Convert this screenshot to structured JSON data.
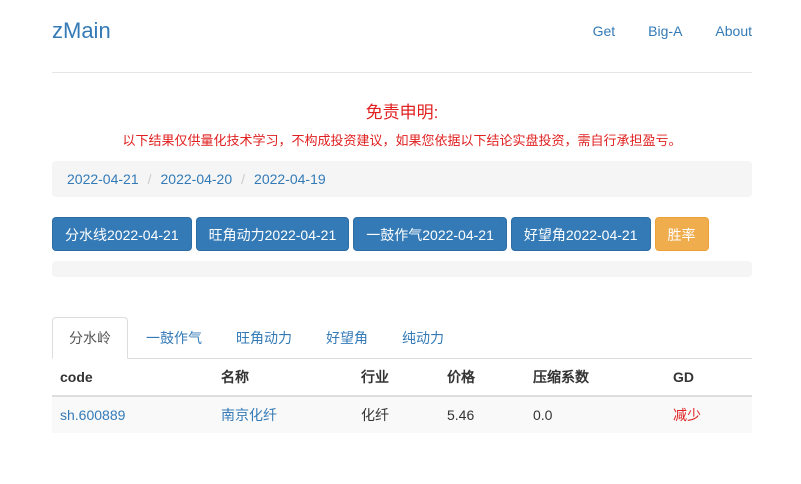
{
  "header": {
    "brand": "zMain",
    "nav": [
      "Get",
      "Big-A",
      "About"
    ]
  },
  "disclaimer": {
    "title": "免责申明:",
    "text": "以下结果仅供量化技术学习，不构成投资建议，如果您依据以下结论实盘投资，需自行承担盈亏。"
  },
  "breadcrumb": [
    "2022-04-21",
    "2022-04-20",
    "2022-04-19"
  ],
  "buttons": [
    "分水线2022-04-21",
    "旺角动力2022-04-21",
    "一鼓作气2022-04-21",
    "好望角2022-04-21",
    "胜率"
  ],
  "tabs": [
    "分水岭",
    "一鼓作气",
    "旺角动力",
    "好望角",
    "纯动力"
  ],
  "table": {
    "headers": [
      "code",
      "名称",
      "行业",
      "价格",
      "压缩系数",
      "GD"
    ],
    "rows": [
      [
        "sh.600889",
        "南京化纤",
        "化纤",
        "5.46",
        "0.0",
        "减少"
      ]
    ]
  },
  "colors": {
    "link": "#337ab7",
    "primary": "#337ab7",
    "warning": "#f0ad4e",
    "alert": "#e02020"
  }
}
